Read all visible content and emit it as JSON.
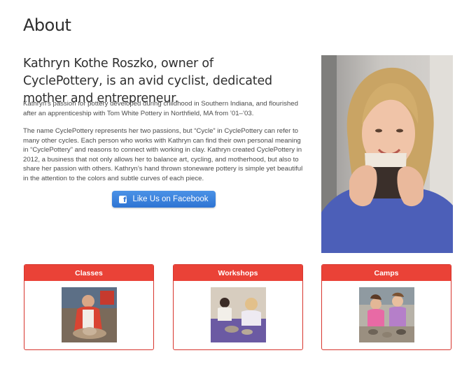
{
  "page": {
    "title": "About",
    "headline": "Kathryn Kothe Roszko, owner of CyclePottery, is an avid cyclist, dedicated mother and entrepreneur.",
    "paragraphs": [
      "Kathryn’s passion for pottery developed during childhood in Southern Indiana, and flourished after an apprenticeship with Tom White Pottery in Northfield, MA from ’01–’03.",
      "The name CyclePottery represents her two passions, but “Cycle” in CyclePottery can refer to many other cycles. Each person who works with Kathryn can find their own personal meaning in “CyclePottery” and reasons to connect with working in clay. Kathryn created CyclePottery in 2012, a business that not only allows her to balance art, cycling, and motherhood, but also to share her passion with others. Kathryn’s hand thrown stoneware pottery is simple yet beautiful in the attention to the colors and subtle curves of each piece."
    ],
    "facebook_button": {
      "label": "Like Us on Facebook",
      "icon": "facebook-icon"
    }
  },
  "cards": [
    {
      "title": "Classes"
    },
    {
      "title": "Workshops"
    },
    {
      "title": "Camps"
    }
  ],
  "colors": {
    "accent_red": "#ea4237",
    "facebook_blue": "#2e74d3",
    "heading_text": "#2e2e2e"
  }
}
